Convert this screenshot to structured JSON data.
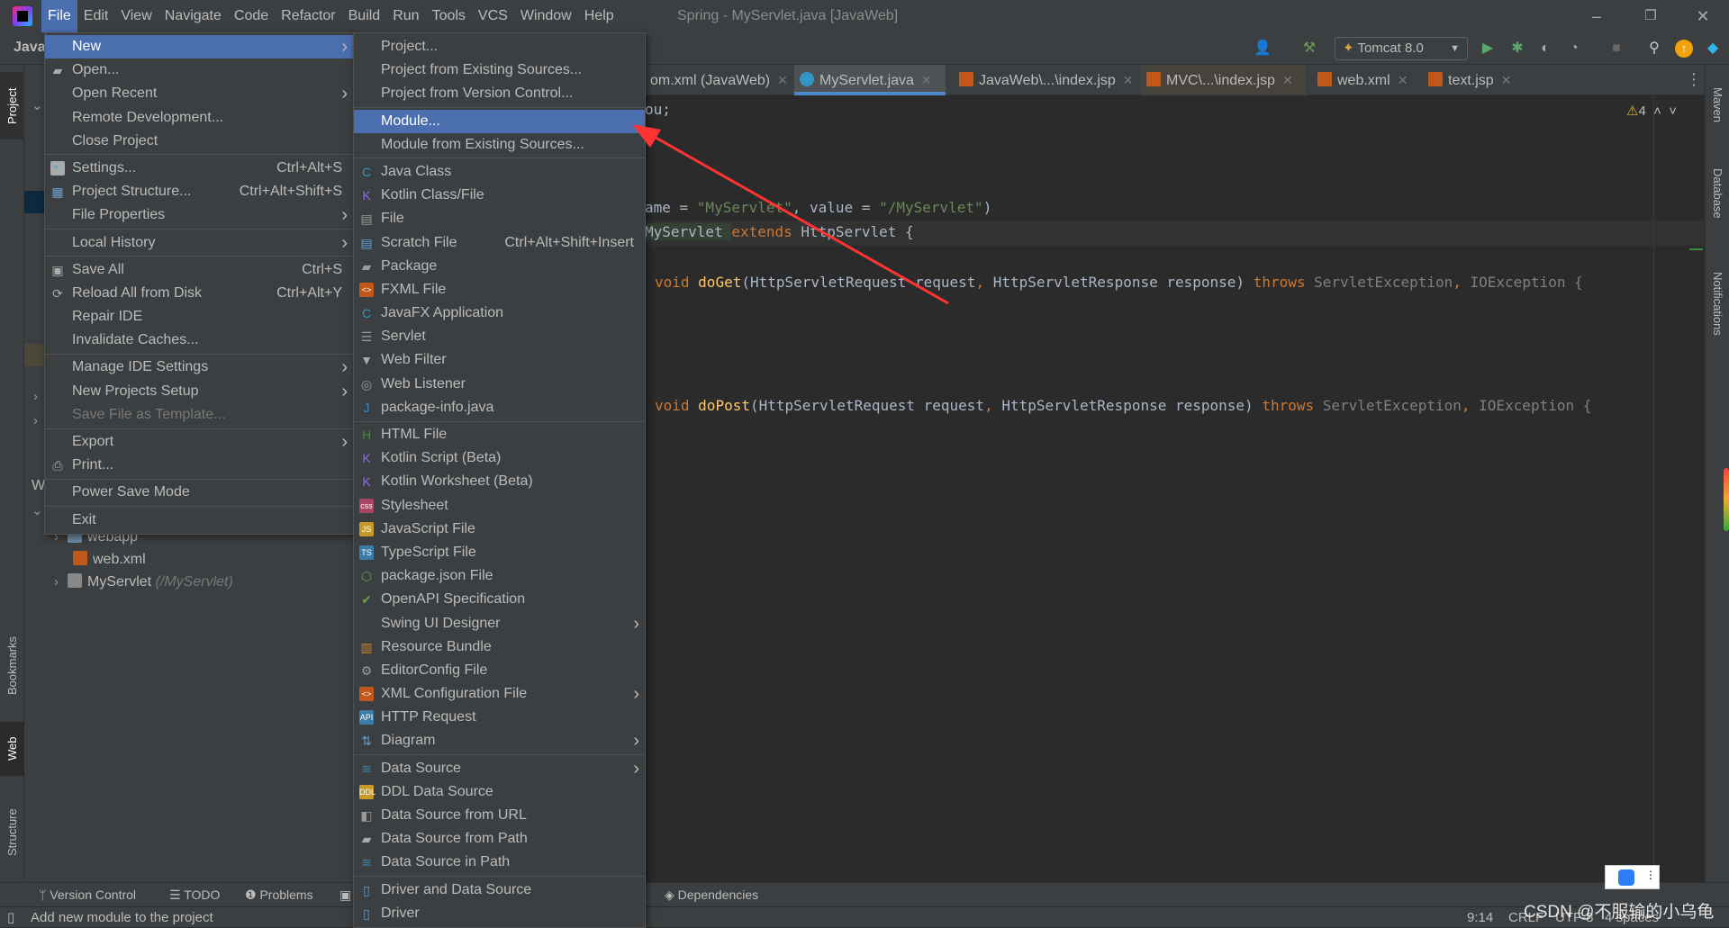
{
  "window": {
    "title": "Spring - MyServlet.java [JavaWeb]",
    "minimize": "–",
    "restore": "❐",
    "close": "✕"
  },
  "menubar": [
    "File",
    "Edit",
    "View",
    "Navigate",
    "Code",
    "Refactor",
    "Build",
    "Run",
    "Tools",
    "VCS",
    "Window",
    "Help"
  ],
  "menubar_active": "File",
  "toolbar": {
    "breadcrumb": "Java",
    "run_config": "Tomcat 8.0",
    "icons": [
      "user-icon",
      "hammer-icon",
      "run-icon",
      "debug-icon",
      "coverage-icon",
      "profile-icon",
      "stop-icon",
      "search-icon",
      "update-icon",
      "toolbox-icon"
    ]
  },
  "tabs": [
    {
      "label": "om.xml (JavaWeb)",
      "icon": "maven-file-icon",
      "active": false
    },
    {
      "label": "MyServlet.java",
      "icon": "java-class-icon",
      "active": true
    },
    {
      "label": "JavaWeb\\...\\index.jsp",
      "icon": "jsp-file-icon",
      "active": false
    },
    {
      "label": "MVC\\...\\index.jsp",
      "icon": "jsp-file-icon",
      "active": false
    },
    {
      "label": "web.xml",
      "icon": "xml-file-icon",
      "active": false
    },
    {
      "label": "text.jsp",
      "icon": "jsp-file-icon",
      "active": false
    }
  ],
  "left_tool_windows": [
    "Project",
    "Bookmarks",
    "Web",
    "Structure"
  ],
  "right_tool_windows": [
    "Maven",
    "Database",
    "Notifications"
  ],
  "project_tree": {
    "partial_label": "W",
    "rows": [
      {
        "label": "webapp",
        "icon": "web-folder-icon"
      },
      {
        "label": "web.xml",
        "icon": "xml-file-icon"
      },
      {
        "label": "MyServlet",
        "hint": "(/MyServlet)",
        "icon": "servlet-icon"
      }
    ]
  },
  "editor": {
    "inspection_count": "4",
    "lines": [
      {
        "parts": [
          [
            "ou;",
            ""
          ]
        ]
      },
      {
        "parts": [
          [
            "ame = ",
            ""
          ],
          [
            "\"MyServlet\"",
            "str"
          ],
          [
            ", value = ",
            ""
          ],
          [
            "\"/MyServlet\"",
            "str"
          ],
          [
            ")",
            ""
          ]
        ]
      },
      {
        "parts": [
          [
            "MyServlet ",
            ""
          ],
          [
            "extends ",
            "kw"
          ],
          [
            "HttpServlet {",
            ""
          ]
        ]
      },
      {
        "parts": [
          [
            "void ",
            "kw"
          ],
          [
            "doGet",
            "fn"
          ],
          [
            "(HttpServletRequest request",
            ""
          ],
          [
            ", ",
            "kw"
          ],
          [
            "HttpServletResponse response) ",
            ""
          ],
          [
            "throws ",
            "kw"
          ],
          [
            "ServletException",
            ""
          ],
          [
            ", ",
            "kw"
          ],
          [
            "IOException {",
            ""
          ]
        ]
      },
      {
        "parts": [
          [
            "void ",
            "kw"
          ],
          [
            "doPost",
            "fn"
          ],
          [
            "(HttpServletRequest request",
            ""
          ],
          [
            ", ",
            "kw"
          ],
          [
            "HttpServletResponse response) ",
            ""
          ],
          [
            "throws ",
            "kw"
          ],
          [
            "ServletException",
            ""
          ],
          [
            ", ",
            "kw"
          ],
          [
            "IOException {",
            ""
          ]
        ]
      }
    ]
  },
  "file_menu": [
    {
      "label": "New",
      "submenu": true,
      "selected": true
    },
    {
      "label": "Open...",
      "icon": "folder-open-icon"
    },
    {
      "label": "Open Recent",
      "submenu": true
    },
    {
      "label": "Remote Development..."
    },
    {
      "label": "Close Project"
    },
    {
      "sep": true
    },
    {
      "label": "Settings...",
      "shortcut": "Ctrl+Alt+S",
      "icon": "wrench-icon"
    },
    {
      "label": "Project Structure...",
      "shortcut": "Ctrl+Alt+Shift+S",
      "icon": "project-structure-icon"
    },
    {
      "label": "File Properties",
      "submenu": true
    },
    {
      "sep": true
    },
    {
      "label": "Local History",
      "submenu": true
    },
    {
      "sep": true
    },
    {
      "label": "Save All",
      "shortcut": "Ctrl+S",
      "icon": "save-icon"
    },
    {
      "label": "Reload All from Disk",
      "shortcut": "Ctrl+Alt+Y",
      "icon": "reload-icon"
    },
    {
      "label": "Repair IDE"
    },
    {
      "label": "Invalidate Caches..."
    },
    {
      "sep": true
    },
    {
      "label": "Manage IDE Settings",
      "submenu": true
    },
    {
      "label": "New Projects Setup",
      "submenu": true
    },
    {
      "label": "Save File as Template...",
      "disabled": true
    },
    {
      "sep": true
    },
    {
      "label": "Export",
      "submenu": true
    },
    {
      "label": "Print...",
      "icon": "print-icon"
    },
    {
      "sep": true
    },
    {
      "label": "Power Save Mode"
    },
    {
      "sep": true
    },
    {
      "label": "Exit"
    }
  ],
  "new_menu": [
    {
      "label": "Project..."
    },
    {
      "label": "Project from Existing Sources..."
    },
    {
      "label": "Project from Version Control..."
    },
    {
      "sep": true
    },
    {
      "label": "Module...",
      "selected": true
    },
    {
      "label": "Module from Existing Sources..."
    },
    {
      "sep": true
    },
    {
      "label": "Java Class",
      "icon": "java-class-icon"
    },
    {
      "label": "Kotlin Class/File",
      "icon": "kotlin-icon"
    },
    {
      "label": "File",
      "icon": "file-icon"
    },
    {
      "label": "Scratch File",
      "shortcut": "Ctrl+Alt+Shift+Insert",
      "icon": "scratch-file-icon"
    },
    {
      "label": "Package",
      "icon": "package-icon"
    },
    {
      "label": "FXML File",
      "icon": "fxml-file-icon"
    },
    {
      "label": "JavaFX Application",
      "icon": "java-class-icon"
    },
    {
      "label": "Servlet",
      "icon": "servlet-icon"
    },
    {
      "label": "Web Filter",
      "icon": "filter-icon"
    },
    {
      "label": "Web Listener",
      "icon": "listener-icon"
    },
    {
      "label": "package-info.java",
      "icon": "java-file-icon"
    },
    {
      "sep": true
    },
    {
      "label": "HTML File",
      "icon": "html-file-icon"
    },
    {
      "label": "Kotlin Script (Beta)",
      "icon": "kotlin-icon"
    },
    {
      "label": "Kotlin Worksheet (Beta)",
      "icon": "kotlin-icon"
    },
    {
      "label": "Stylesheet",
      "icon": "css-file-icon"
    },
    {
      "label": "JavaScript File",
      "icon": "js-file-icon"
    },
    {
      "label": "TypeScript File",
      "icon": "ts-file-icon"
    },
    {
      "label": "package.json File",
      "icon": "nodejs-icon"
    },
    {
      "label": "OpenAPI Specification",
      "icon": "openapi-icon"
    },
    {
      "label": "Swing UI Designer",
      "submenu": true
    },
    {
      "label": "Resource Bundle",
      "icon": "resource-bundle-icon"
    },
    {
      "label": "EditorConfig File",
      "icon": "gear-icon"
    },
    {
      "label": "XML Configuration File",
      "submenu": true,
      "icon": "xml-config-icon"
    },
    {
      "label": "HTTP Request",
      "icon": "api-file-icon"
    },
    {
      "label": "Diagram",
      "submenu": true,
      "icon": "diagram-icon"
    },
    {
      "sep": true
    },
    {
      "label": "Data Source",
      "submenu": true,
      "icon": "database-icon"
    },
    {
      "label": "DDL Data Source",
      "icon": "ddl-icon"
    },
    {
      "label": "Data Source from URL",
      "icon": "plug-icon"
    },
    {
      "label": "Data Source from Path",
      "icon": "folder-open-icon"
    },
    {
      "label": "Data Source in Path",
      "icon": "database-icon"
    },
    {
      "sep": true
    },
    {
      "label": "Driver and Data Source",
      "icon": "driver-icon"
    },
    {
      "label": "Driver",
      "icon": "driver-icon"
    }
  ],
  "bottom_tools": [
    {
      "label": "Version Control",
      "icon": "branch-icon"
    },
    {
      "label": "TODO",
      "icon": "list-icon"
    },
    {
      "label": "Problems",
      "icon": "problems-icon"
    },
    {
      "label": "",
      "icon": "terminal-icon"
    },
    {
      "label": "Dependencies",
      "icon": "layers-icon"
    }
  ],
  "status": {
    "message": "Add new module to the project",
    "position": "9:14",
    "line_sep": "CRLF",
    "encoding": "UTF-8",
    "indent": "4 spaces"
  },
  "watermark": "CSDN @不服输的小乌龟",
  "colors": {
    "accent": "#4b6eaf",
    "annotation_arrow": "#ff3333",
    "tab_underline": "#4a88c7"
  }
}
